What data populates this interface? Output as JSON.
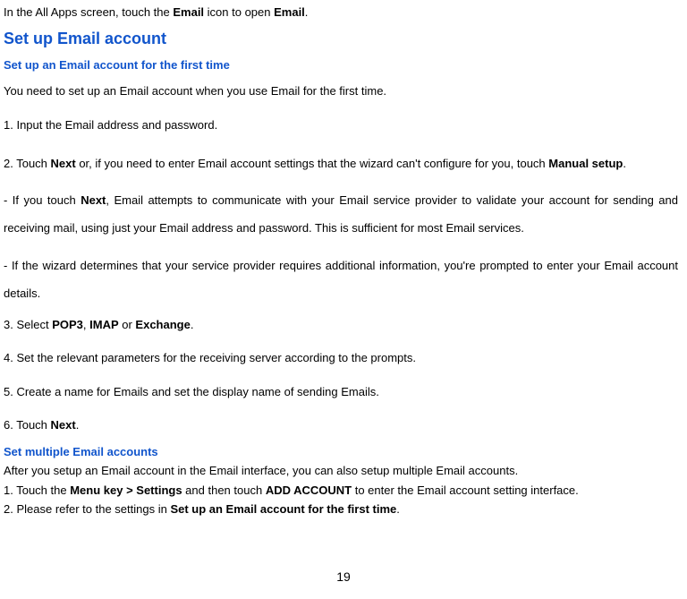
{
  "intro": {
    "pre": "In the All Apps screen, touch the ",
    "bold1": "Email",
    "mid": " icon to open ",
    "bold2": "Email",
    "post": "."
  },
  "h1": "Set up Email account",
  "h2a": "Set up an Email account for the first time",
  "p1": "You need to set up an Email account when you use Email for the first time.",
  "p2": "1. Input the Email address and password.",
  "p3": {
    "pre": "2. Touch ",
    "bold1": "Next",
    "mid": " or, if you need to enter Email account settings that the wizard can't configure for you, touch ",
    "bold2": "Manual setup",
    "post": "."
  },
  "p4": {
    "pre": "- If you touch ",
    "bold1": "Next",
    "post": ", Email attempts to communicate with your Email service provider to validate your account for sending and receiving mail, using just your Email address and password. This is sufficient for most Email services."
  },
  "p5": "- If the wizard determines that your service provider requires additional information, you're prompted to enter your Email account details.",
  "p6": {
    "pre": "3. Select ",
    "bold1": "POP3",
    "mid1": ", ",
    "bold2": "IMAP",
    "mid2": " or ",
    "bold3": "Exchange",
    "post": "."
  },
  "p7": "4. Set the relevant parameters for the receiving server according to the prompts.",
  "p8": "5. Create a name for Emails and set the display name of sending Emails.",
  "p9": {
    "pre": "6. Touch ",
    "bold1": "Next",
    "post": "."
  },
  "h2b": "Set multiple Email accounts",
  "p10": "After you setup an Email account in the Email interface, you can also setup multiple Email accounts.",
  "p11": {
    "pre": "1. Touch the ",
    "bold1": "Menu key > Settings",
    "mid": " and then touch ",
    "bold2": "ADD ACCOUNT",
    "post": " to enter the Email account setting interface."
  },
  "p12": {
    "pre": "2. Please refer to the settings in ",
    "bold1": "Set up an Email account for the first time",
    "post": "."
  },
  "pageNumber": "19"
}
